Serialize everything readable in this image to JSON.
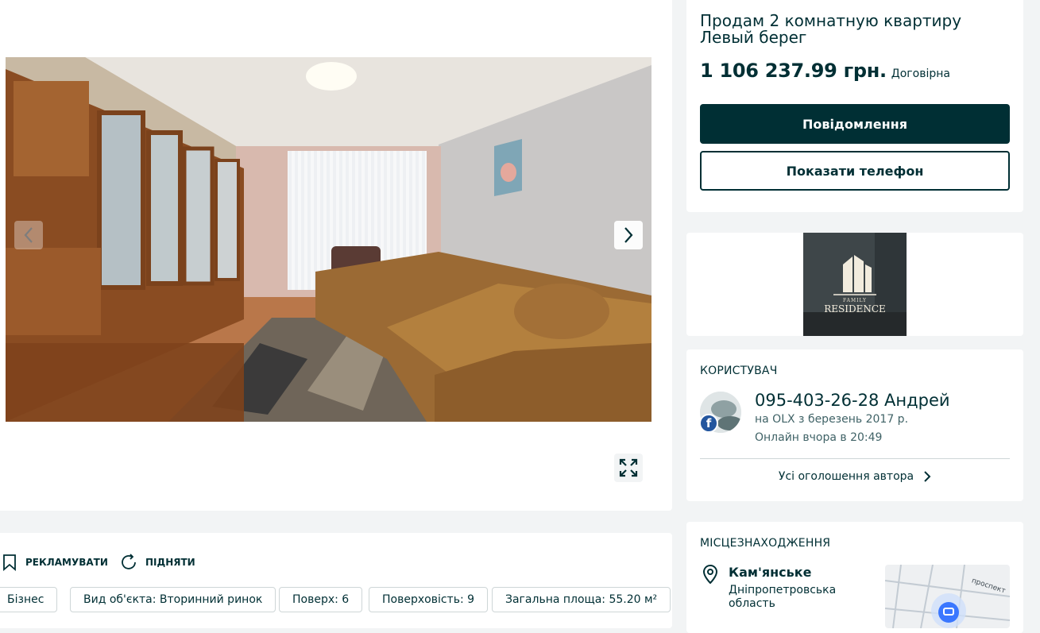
{
  "gallery": {
    "prev_label": "previous-photo",
    "next_label": "next-photo"
  },
  "ad": {
    "title": "Продам 2 комнатную квартиру Левый берег",
    "price": "1 106 237.99 грн.",
    "negotiable": "Договірна",
    "message_button": "Повідомлення",
    "phone_button": "Показати телефон"
  },
  "banner": {
    "line1": "FAMILY",
    "line2": "RESIDENCE"
  },
  "user": {
    "section_label": "КОРИСТУВАЧ",
    "name": "095-403-26-28 Андрей",
    "member_since": "на OLX з березень 2017 р.",
    "last_seen": "Онлайн вчора в 20:49",
    "all_ads_link": "Усі оголошення автора",
    "badge": "f"
  },
  "location": {
    "section_label": "МІСЦЕЗНАХОДЖЕННЯ",
    "city": "Кам'янське",
    "region": "Дніпропетровська область",
    "map_street": "проспект"
  },
  "actions": {
    "promote": "РЕКЛАМУВАТИ",
    "raise": "ПІДНЯТИ"
  },
  "tags": [
    "Бізнес",
    "Вид об'єкта: Вторинний ринок",
    "Поверх: 6",
    "Поверховість: 9",
    "Загальна площа: 55.20 м²"
  ],
  "icons": {
    "prev": "chevron-left-icon",
    "next": "chevron-right-icon",
    "fullscreen": "expand-icon",
    "bookmark": "bookmark-icon",
    "refresh": "refresh-icon",
    "pin": "location-pin-icon",
    "chevron": "chevron-right-icon"
  },
  "colors": {
    "primary": "#002f34",
    "background": "#f2f4f5",
    "facebook": "#23569e"
  }
}
